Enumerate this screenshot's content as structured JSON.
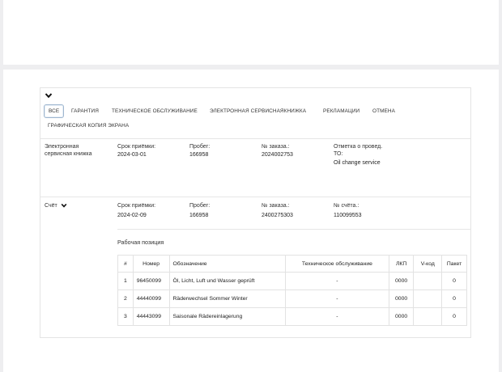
{
  "tabs": [
    {
      "label": "ВСЕ",
      "active": true
    },
    {
      "label": "ГАРАНТИЯ"
    },
    {
      "label": "ТЕХНИЧЕСКОЕ ОБСЛУЖИВАНИЕ"
    },
    {
      "label": "ЭЛЕКТРОННАЯ СЕРВИСНАЯКНИЖКА"
    },
    {
      "label": "РЕКЛАМАЦИИ"
    },
    {
      "label": "ОТМЕНА"
    },
    {
      "label": "ГРАФИЧЕСКАЯ КОПИЯ ЭКРАНА"
    }
  ],
  "record1": {
    "type_line1": "Электронная",
    "type_line2": "сервисная книжка",
    "date_label": "Срок приёмки:",
    "date_value": "2024-03-01",
    "mileage_label": "Пробег:",
    "mileage_value": "166958",
    "order_label": "№ заказа.:",
    "order_value": "2024002753",
    "note_label_line1": "Отметка о провед.",
    "note_label_line2": "ТО:",
    "note_value": "Oil change service"
  },
  "record2": {
    "type": "Счёт",
    "date_label": "Срок приёмки:",
    "date_value": "2024-02-09",
    "mileage_label": "Пробег:",
    "mileage_value": "166958",
    "order_label": "№ заказа.:",
    "order_value": "2400275303",
    "invoice_label": "№ счёта.:",
    "invoice_value": "110099553"
  },
  "positions_title": "Рабочая позиция",
  "table": {
    "headers": [
      "#",
      "Номер",
      "Обозначение",
      "Техническое обслуживание",
      "ЛКП",
      "V-код",
      "Пакет"
    ],
    "rows": [
      [
        "1",
        "96450099",
        "Öl, Licht, Luft und Wasser geprüft",
        "-",
        "0000",
        "",
        "0"
      ],
      [
        "2",
        "44440099",
        "Räderwechsel Sommer Winter",
        "-",
        "0000",
        "",
        "0"
      ],
      [
        "3",
        "44443099",
        "Saisonale Rädereinlagerung",
        "-",
        "0000",
        "",
        "0"
      ]
    ]
  },
  "icons": {
    "collapse": "chevron-down-icon",
    "expand": "chevron-down-icon"
  }
}
